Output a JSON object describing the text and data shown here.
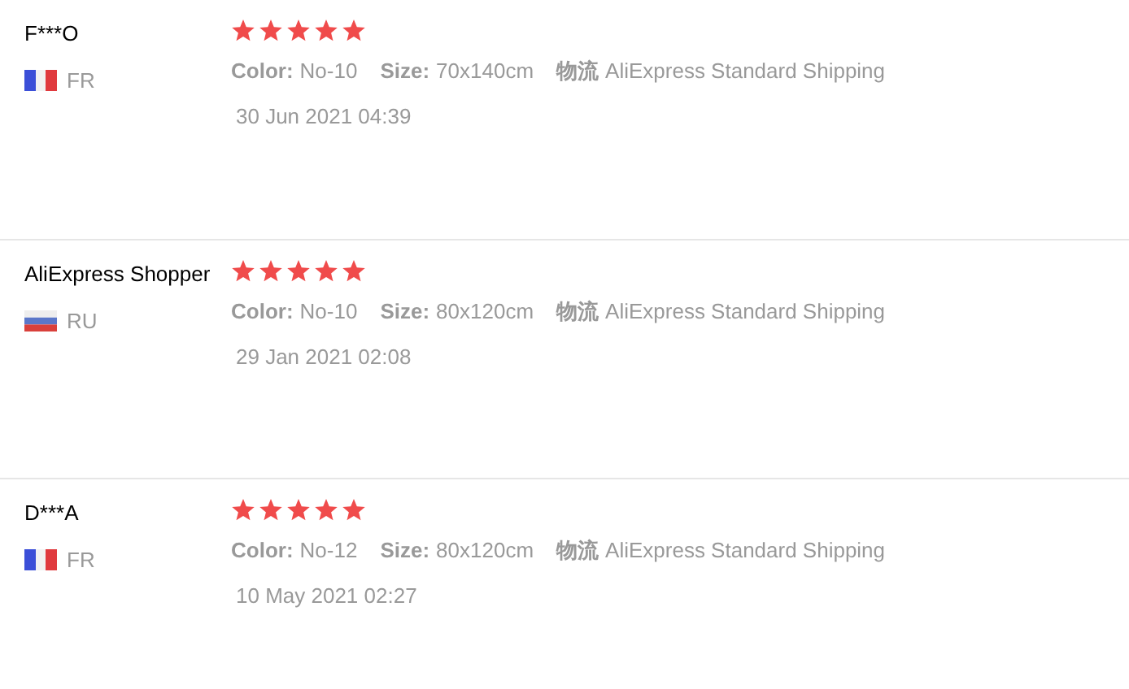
{
  "reviews": [
    {
      "name": "F***O",
      "country": {
        "code": "FR",
        "kind": "fr"
      },
      "stars": 5,
      "attributes": [
        {
          "label": "Color:",
          "value": "No-10"
        },
        {
          "label": "Size:",
          "value": "70x140cm"
        },
        {
          "label": "物流",
          "value": "AliExpress Standard Shipping"
        }
      ],
      "date": "30 Jun 2021 04:39"
    },
    {
      "name": "AliExpress Shopper",
      "country": {
        "code": "RU",
        "kind": "ru"
      },
      "stars": 5,
      "attributes": [
        {
          "label": "Color:",
          "value": "No-10"
        },
        {
          "label": "Size:",
          "value": "80x120cm"
        },
        {
          "label": "物流",
          "value": "AliExpress Standard Shipping"
        }
      ],
      "date": "29 Jan 2021 02:08"
    },
    {
      "name": "D***A",
      "country": {
        "code": "FR",
        "kind": "fr"
      },
      "stars": 5,
      "attributes": [
        {
          "label": "Color:",
          "value": "No-12"
        },
        {
          "label": "Size:",
          "value": "80x120cm"
        },
        {
          "label": "物流",
          "value": "AliExpress Standard Shipping"
        }
      ],
      "date": "10 May 2021 02:27"
    }
  ]
}
